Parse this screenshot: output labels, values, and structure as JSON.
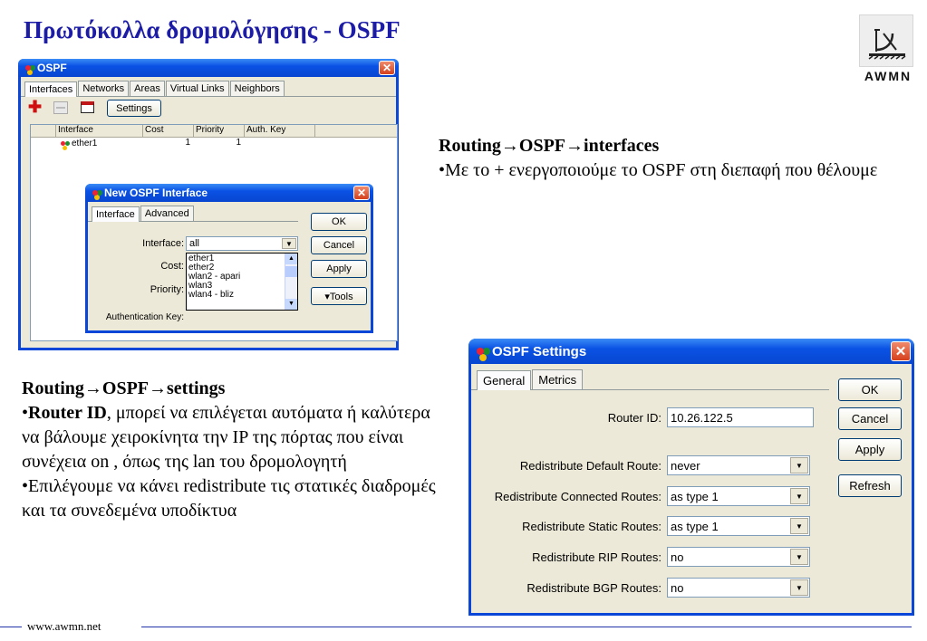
{
  "slide": {
    "title": "Πρωτόκολλα δρομολόγησης - OSPF",
    "logo_text": "AWMN",
    "footer": "www.awmn.net"
  },
  "ospf_window": {
    "title": "OSPF",
    "tabs": [
      "Interfaces",
      "Networks",
      "Areas",
      "Virtual Links",
      "Neighbors"
    ],
    "settings_button": "Settings",
    "columns": [
      "Interface",
      "Cost",
      "Priority",
      "Auth. Key"
    ],
    "rows": [
      {
        "interface": "ether1",
        "cost": "1",
        "priority": "1",
        "auth_key": ""
      }
    ]
  },
  "new_interface_dialog": {
    "title": "New OSPF Interface",
    "tabs": [
      "Interface",
      "Advanced"
    ],
    "labels": {
      "interface": "Interface:",
      "cost": "Cost:",
      "priority": "Priority:",
      "auth_key": "Authentication Key:"
    },
    "interface_value": "all",
    "dropdown_options": [
      "ether1",
      "ether2",
      "wlan2 - apari",
      "wlan3",
      "wlan4 - bliz"
    ],
    "buttons": {
      "ok": "OK",
      "cancel": "Cancel",
      "apply": "Apply",
      "tools": "▾Tools"
    }
  },
  "settings_window": {
    "title": "OSPF Settings",
    "tabs": [
      "General",
      "Metrics"
    ],
    "fields": {
      "router_id_label": "Router ID:",
      "router_id_value": "10.26.122.5",
      "default_label": "Redistribute Default Route:",
      "default_value": "never",
      "connected_label": "Redistribute Connected Routes:",
      "connected_value": "as type 1",
      "static_label": "Redistribute Static Routes:",
      "static_value": "as type 1",
      "rip_label": "Redistribute RIP Routes:",
      "rip_value": "no",
      "bgp_label": "Redistribute BGP Routes:",
      "bgp_value": "no"
    },
    "buttons": {
      "ok": "OK",
      "cancel": "Cancel",
      "apply": "Apply",
      "refresh": "Refresh"
    }
  },
  "text_right": {
    "heading": "Routing→OSPF→interfaces",
    "bullet": "•Με το + ενεργοποιούμε το OSPF στη διεπαφή που θέλουμε"
  },
  "text_left": {
    "heading": "Routing→OSPF→settings",
    "bullet1_bold": "Router ID",
    "bullet1_rest": ", μπορεί να επιλέγεται αυτόματα ή καλύτερα να βάλουμε χειροκίνητα την IP της πόρτας που είναι συνέχεια on , όπως της lan του δρομολογητή",
    "bullet2": "•Επιλέγουμε να κάνει redistribute τις στατικές διαδρομές και τα συνεδεμένα υποδίκτυα"
  }
}
